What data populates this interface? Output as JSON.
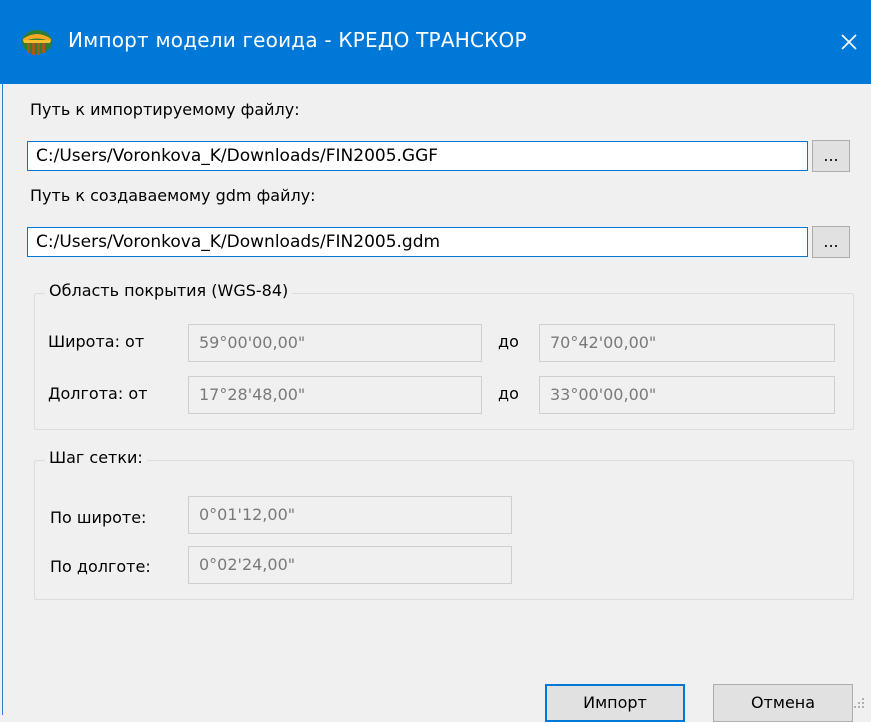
{
  "window": {
    "title": "Импорт модели геоида - КРЕДО ТРАНСКОР",
    "icon": "credo-app-icon",
    "close_icon": "close-icon",
    "title_bar_color": "#0078d7"
  },
  "import_path": {
    "label": "Путь к импортируемому файлу:",
    "value": "C:/Users/Voronkova_K/Downloads/FIN2005.GGF",
    "browse_label": "..."
  },
  "output_path": {
    "label": "Путь к создаваемому gdm файлу:",
    "value": "C:/Users/Voronkova_K/Downloads/FIN2005.gdm",
    "browse_label": "..."
  },
  "coverage": {
    "legend": "Область покрытия (WGS-84)",
    "lat_label": "Широта: от",
    "lat_from": "59°00'00,00\"",
    "lat_to_label": "до",
    "lat_to": "70°42'00,00\"",
    "lon_label": "Долгота: от",
    "lon_from": "17°28'48,00\"",
    "lon_to_label": "до",
    "lon_to": "33°00'00,00\""
  },
  "grid_step": {
    "legend": "Шаг сетки:",
    "lat_label": "По широте:",
    "lat_value": "0°01'12,00\"",
    "lon_label": "По долготе:",
    "lon_value": "0°02'24,00\""
  },
  "buttons": {
    "import_label": "Импорт",
    "cancel_label": "Отмена"
  }
}
